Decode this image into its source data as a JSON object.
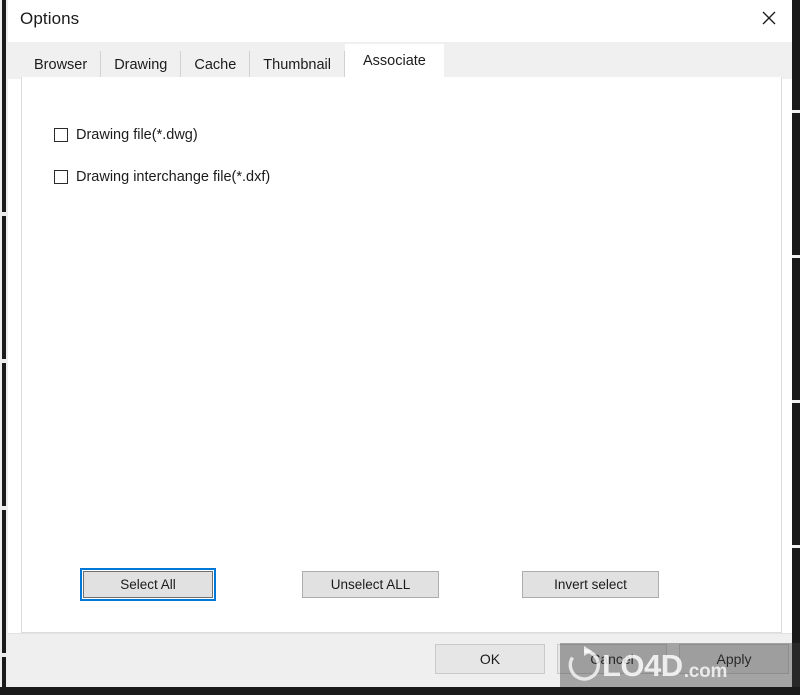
{
  "window": {
    "title": "Options",
    "close_icon": "close-icon"
  },
  "tabs": [
    {
      "label": "Browser",
      "active": false
    },
    {
      "label": "Drawing",
      "active": false
    },
    {
      "label": "Cache",
      "active": false
    },
    {
      "label": "Thumbnail",
      "active": false
    },
    {
      "label": "Associate",
      "active": true
    }
  ],
  "associate_panel": {
    "checkboxes": [
      {
        "label": "Drawing file(*.dwg)",
        "checked": false
      },
      {
        "label": "Drawing interchange file(*.dxf)",
        "checked": false
      }
    ],
    "actions": [
      {
        "label": "Select All",
        "focused": true
      },
      {
        "label": "Unselect ALL",
        "focused": false
      },
      {
        "label": "Invert select",
        "focused": false
      }
    ]
  },
  "footer": {
    "ok_label": "OK",
    "cancel_label": "Cancel",
    "apply_label": "Apply"
  },
  "watermark": {
    "brand": "LO4D",
    "tld": ".com"
  },
  "colors": {
    "accent_focus": "#0078d7",
    "dialog_bg": "#ffffff",
    "tabstrip_bg": "#f0f0f0",
    "button_face": "#e1e1e1",
    "footer_bg": "#efefef"
  }
}
